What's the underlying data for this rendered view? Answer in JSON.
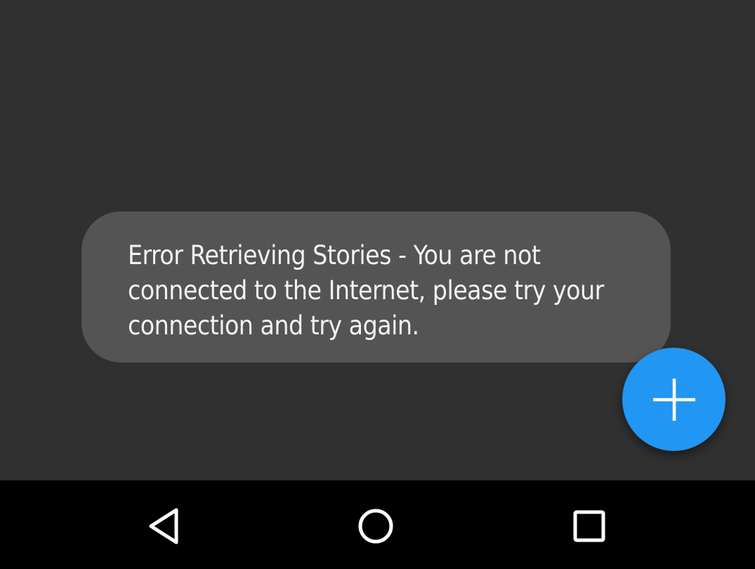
{
  "toast": {
    "message": "Error Retrieving Stories - You are not connected to the Internet, please try your connection and try again."
  },
  "fab": {
    "icon": "plus-icon",
    "color": "#2196f3"
  },
  "navbar": {
    "back_icon": "back-triangle-icon",
    "home_icon": "home-circle-icon",
    "recents_icon": "recents-square-icon"
  },
  "colors": {
    "background": "#303030",
    "toast_background": "#545454",
    "navbar_background": "#000000",
    "accent": "#2196f3"
  }
}
